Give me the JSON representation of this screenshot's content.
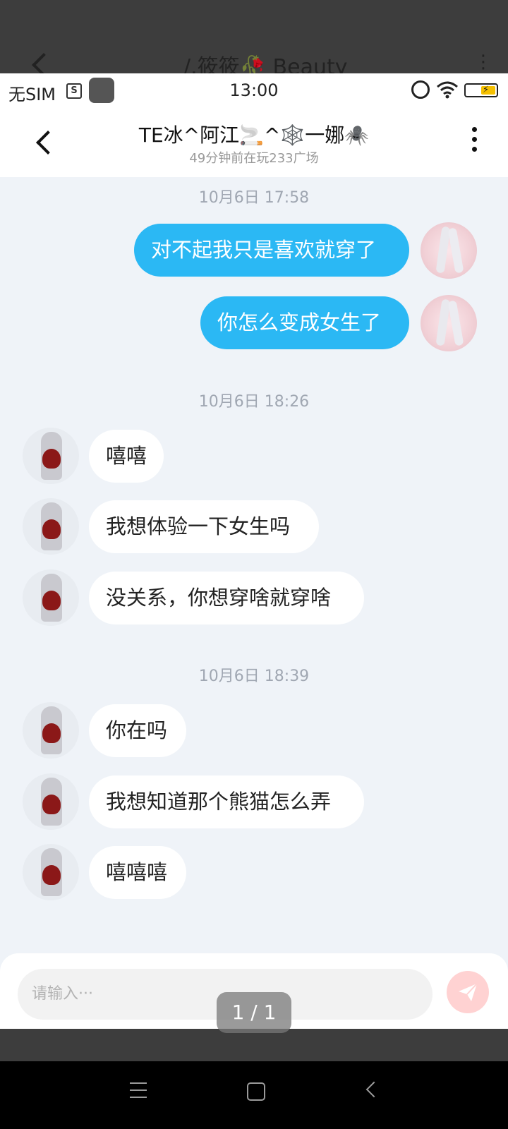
{
  "background_window": {
    "title": "/.筱筱🥀  Beauty"
  },
  "status_bar": {
    "carrier": "无SIM",
    "sim_icon_text": "S",
    "time": "13:00"
  },
  "header": {
    "title": "TE冰^阿江🚬^🕸️一娜🕷️",
    "subtitle": "49分钟前在玩233广场"
  },
  "messages": [
    {
      "type": "timestamp",
      "text": "10月6日 17:58"
    },
    {
      "type": "outgoing",
      "text": "对不起我只是喜欢就穿了"
    },
    {
      "type": "outgoing",
      "text": "你怎么变成女生了"
    },
    {
      "type": "timestamp",
      "text": "10月6日 18:26"
    },
    {
      "type": "incoming",
      "text": "嘻嘻"
    },
    {
      "type": "incoming",
      "text": "我想体验一下女生吗"
    },
    {
      "type": "incoming",
      "text": "没关系，你想穿啥就穿啥"
    },
    {
      "type": "timestamp",
      "text": "10月6日 18:39"
    },
    {
      "type": "incoming",
      "text": "你在吗"
    },
    {
      "type": "incoming",
      "text": "我想知道那个熊猫怎么弄"
    },
    {
      "type": "incoming",
      "text": "嘻嘻嘻"
    }
  ],
  "composer": {
    "placeholder": "请输入···"
  },
  "pager": {
    "text": "1 / 1"
  },
  "colors": {
    "outgoing_bubble": "#2bb8f4",
    "incoming_bubble": "#ffffff",
    "chat_background": "#eff3f8",
    "send_button": "#ffd2d2"
  },
  "icons": [
    "chevron-left-icon",
    "more-vertical-icon",
    "send-icon",
    "emoji-mascot-icon",
    "image-icon",
    "alarm-icon",
    "wifi-icon",
    "battery-icon",
    "menu-icon",
    "home-icon",
    "nav-back-icon"
  ]
}
